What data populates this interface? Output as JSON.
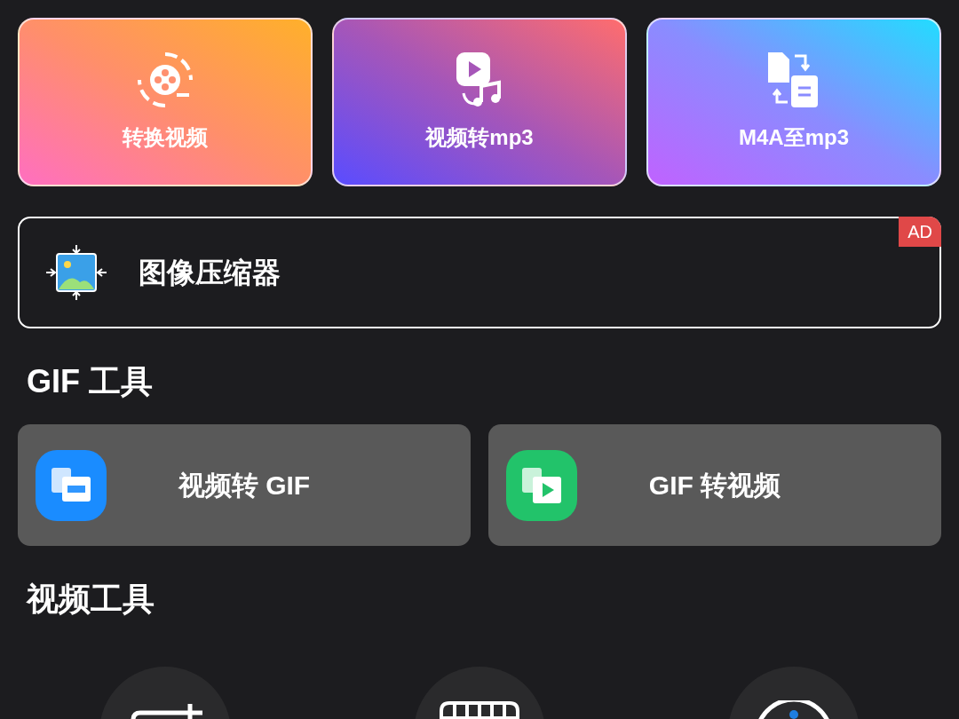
{
  "top_tools": [
    {
      "label": "转换视频",
      "kind": "reel"
    },
    {
      "label": "视频转mp3",
      "kind": "video-music"
    },
    {
      "label": "M4A至mp3",
      "kind": "file-swap"
    }
  ],
  "ad_banner": {
    "label": "图像压缩器",
    "badge": "AD"
  },
  "gif_tools": {
    "title": "GIF 工具",
    "items": [
      {
        "label": "视频转 GIF",
        "kind": "to-gif"
      },
      {
        "label": "GIF 转视频",
        "kind": "from-gif"
      }
    ]
  },
  "video_tools": {
    "title": "视频工具",
    "items": [
      {
        "kind": "crop"
      },
      {
        "kind": "film"
      },
      {
        "kind": "timer"
      }
    ]
  }
}
